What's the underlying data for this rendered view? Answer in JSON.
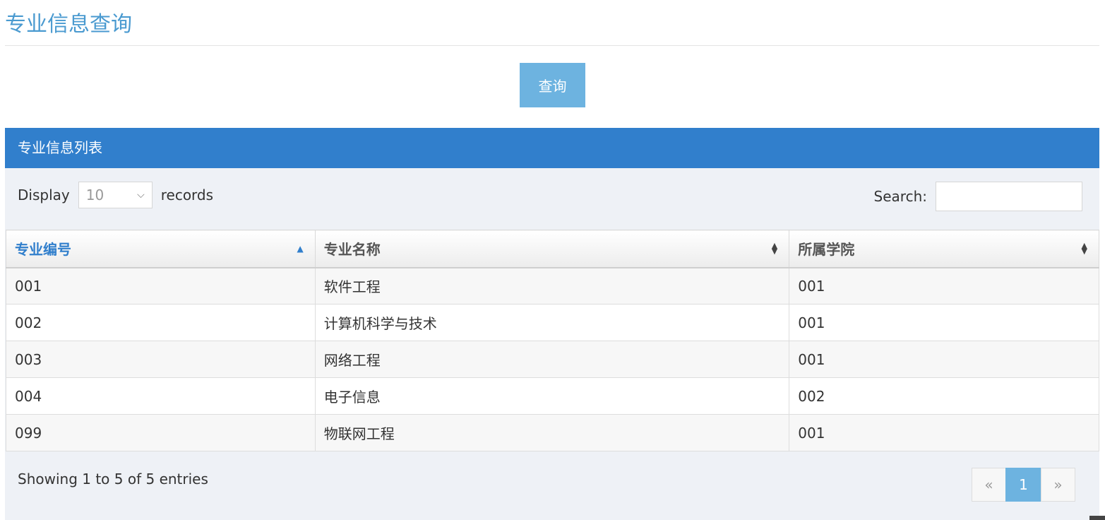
{
  "page": {
    "title": "专业信息查询"
  },
  "toolbar": {
    "query_label": "查询"
  },
  "panel": {
    "title": "专业信息列表"
  },
  "length_menu": {
    "prefix": "Display",
    "value": "10",
    "suffix": "records"
  },
  "search": {
    "label": "Search:",
    "value": ""
  },
  "table": {
    "columns": [
      "专业编号",
      "专业名称",
      "所属学院"
    ],
    "sorted_column": "专业编号",
    "sort_direction": "ascending",
    "rows": [
      [
        "001",
        "软件工程",
        "001"
      ],
      [
        "002",
        "计算机科学与技术",
        "001"
      ],
      [
        "003",
        "网络工程",
        "001"
      ],
      [
        "004",
        "电子信息",
        "002"
      ],
      [
        "099",
        "物联网工程",
        "001"
      ]
    ]
  },
  "footer": {
    "info": "Showing 1 to 5 of 5 entries"
  },
  "pagination": {
    "prev": "«",
    "current": "1",
    "next": "»"
  },
  "colors": {
    "accent": "#317fcc",
    "button": "#6db3e0",
    "title": "#4a9ad0",
    "panel_bg": "#eef1f6"
  },
  "icons": {
    "select": "chevron-down-icon",
    "sort_active": "sort-asc-icon",
    "sort": "sort-both-icon"
  }
}
